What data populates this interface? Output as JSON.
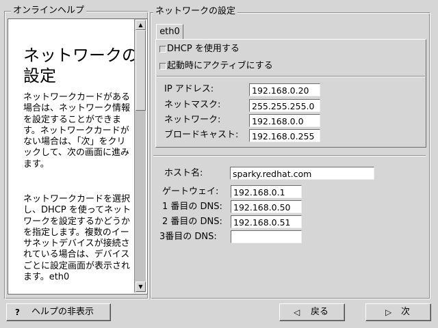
{
  "help": {
    "frame_title": "オンラインヘルプ",
    "title": "ネットワークの設定",
    "paragraphs": [
      "ネットワークカードがある場合は、ネットワーク情報を設定することができます。ネットワークカードがない場合は、「次」をクリックして、次の画面に進みます。",
      "ネットワークカードを選択し、DHCP を使ってネットワークを設定するかどうかを指定します。複数のイーサネットデバイスが接続されている場合は、デバイスごとに設定画面が表示されます。eth0"
    ]
  },
  "network": {
    "frame_title": "ネットワークの設定",
    "tab_label": "eth0",
    "dhcp_label": "DHCP を使用する",
    "dhcp_checked": false,
    "activate_label": "起動時にアクティブにする",
    "activate_checked": false,
    "ip_label": "IP アドレス:",
    "ip_value": "192.168.0.20",
    "netmask_label": "ネットマスク:",
    "netmask_value": "255.255.255.0",
    "network_label": "ネットワーク:",
    "network_value": "192.168.0.0",
    "broadcast_label": "ブロードキャスト:",
    "broadcast_value": "192.168.0.255"
  },
  "host": {
    "hostname_label": "ホスト名:",
    "hostname_value": "sparky.redhat.com",
    "gateway_label": "ゲートウェイ:",
    "gateway_value": "192.168.0.1",
    "dns1_label": "1 番目の DNS:",
    "dns1_value": "192.168.0.50",
    "dns2_label": "2 番目の DNS:",
    "dns2_value": "192.168.0.51",
    "dns3_label": "3番目の DNS:",
    "dns3_value": ""
  },
  "buttons": {
    "hide_help": "ヘルプの非表示",
    "back": "戻る",
    "next": "次"
  },
  "icons": {
    "hide_help": "question-mark-icon",
    "back": "left-triangle-icon",
    "next": "right-triangle-icon"
  }
}
